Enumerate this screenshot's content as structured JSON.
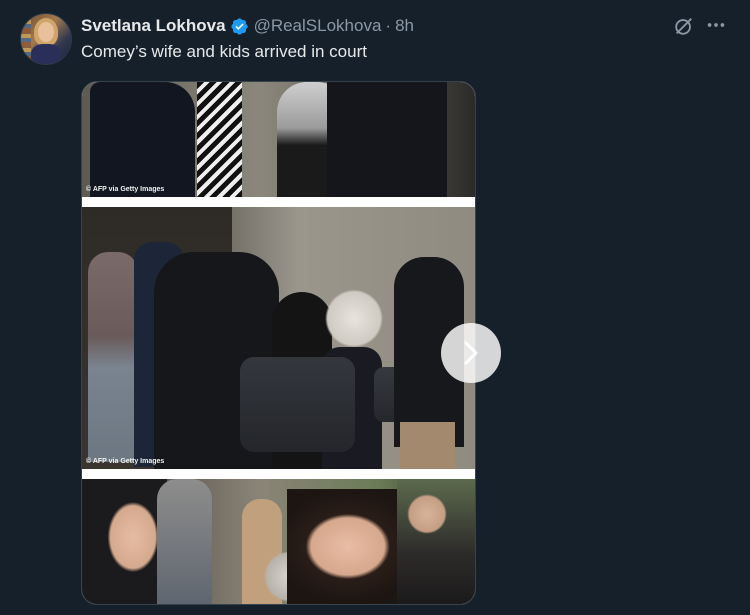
{
  "tweet": {
    "display_name": "Svetlana Lokhova",
    "handle": "@RealSLokhova",
    "separator": "·",
    "time": "8h",
    "text": "Comey’s wife and kids arrived in court",
    "verified": true
  },
  "media": {
    "photos": [
      {
        "credit": "© AFP via Getty Images"
      },
      {
        "credit": "© AFP via Getty Images"
      },
      {
        "credit": ""
      }
    ]
  },
  "icons": {
    "verified": "verified-badge-icon",
    "grok": "grok-icon",
    "more": "more-options-icon",
    "next": "chevron-right-icon"
  },
  "colors": {
    "background": "#15202b",
    "text_primary": "#e7e9ea",
    "text_secondary": "#8b98a5",
    "verified_blue": "#1d9bf0"
  }
}
